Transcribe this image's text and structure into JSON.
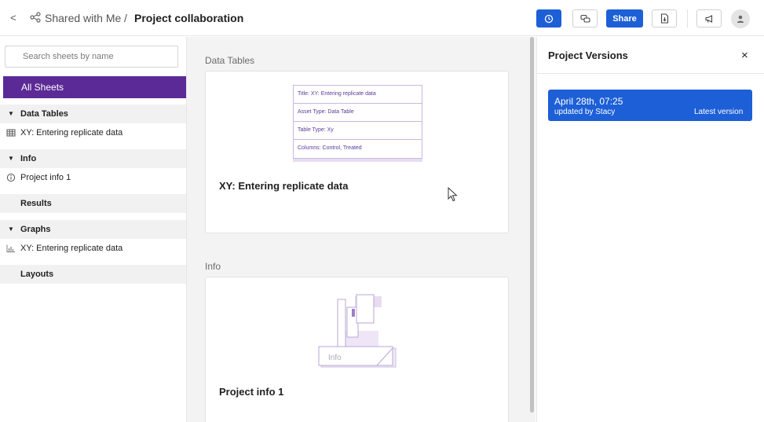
{
  "header": {
    "back_label": "<",
    "breadcrumb_parent": "Shared with Me",
    "breadcrumb_separator": "/",
    "title": "Project collaboration",
    "share_label": "Share",
    "icons": [
      "back-icon",
      "share-network-icon",
      "history-icon",
      "comment-icon",
      "export-icon",
      "megaphone-icon",
      "user-icon"
    ]
  },
  "sidebar": {
    "search_placeholder": "Search sheets by name",
    "all_sheets_label": "All Sheets",
    "sections": {
      "data_tables": {
        "label": "Data Tables",
        "items": [
          "XY: Entering replicate data"
        ]
      },
      "info": {
        "label": "Info",
        "items": [
          "Project info 1"
        ]
      },
      "results": {
        "label": "Results"
      },
      "graphs": {
        "label": "Graphs",
        "items": [
          "XY: Entering replicate data"
        ]
      },
      "layouts": {
        "label": "Layouts"
      }
    }
  },
  "main": {
    "data_tables_title": "Data Tables",
    "data_table_card": {
      "thumbnail_rows": [
        "Title: XY: Entering replicate data",
        "Asset Type: Data Table",
        "Table Type: Xy",
        "Columns: Control, Treated"
      ],
      "title": "XY: Entering replicate data"
    },
    "info_title": "Info",
    "info_card": {
      "thumbnail_label": "Info",
      "title": "Project info 1"
    }
  },
  "versions_panel": {
    "title": "Project Versions",
    "close_label": "×",
    "versions": [
      {
        "date": "April 28th, 07:25",
        "updated_by": "updated by Stacy",
        "badge": "Latest version"
      }
    ]
  },
  "colors": {
    "accent_blue": "#1d5fd6",
    "accent_purple": "#5b2a96"
  }
}
